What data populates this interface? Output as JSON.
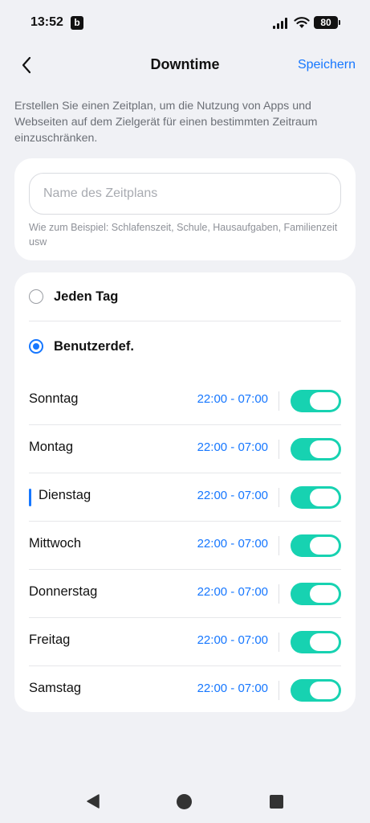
{
  "status_bar": {
    "time": "13:52",
    "app_badge": "b",
    "battery": "80"
  },
  "header": {
    "title": "Downtime",
    "save_label": "Speichern"
  },
  "description": "Erstellen Sie einen Zeitplan, um die Nutzung von Apps und Webseiten auf dem Zielgerät für einen bestimmten Zeitraum einzuschränken.",
  "name_card": {
    "placeholder": "Name des Zeitplans",
    "value": "",
    "hint": "Wie zum Beispiel: Schlafenszeit, Schule, Hausaufgaben, Familienzeit usw"
  },
  "schedule": {
    "options": [
      {
        "label": "Jeden Tag",
        "selected": false
      },
      {
        "label": "Benutzerdef.",
        "selected": true
      }
    ],
    "days": [
      {
        "name": "Sonntag",
        "time": "22:00 - 07:00",
        "enabled": true
      },
      {
        "name": "Montag",
        "time": "22:00 - 07:00",
        "enabled": true
      },
      {
        "name": "Dienstag",
        "time": "22:00 - 07:00",
        "enabled": true,
        "focused": true
      },
      {
        "name": "Mittwoch",
        "time": "22:00 - 07:00",
        "enabled": true
      },
      {
        "name": "Donnerstag",
        "time": "22:00 - 07:00",
        "enabled": true
      },
      {
        "name": "Freitag",
        "time": "22:00 - 07:00",
        "enabled": true
      },
      {
        "name": "Samstag",
        "time": "22:00 - 07:00",
        "enabled": true
      }
    ]
  },
  "colors": {
    "accent": "#1677ff",
    "toggle_on": "#17d2b1",
    "background": "#f0f1f5"
  },
  "icons": {
    "back": "chevron-left-icon",
    "nav_back": "triangle-back-icon",
    "nav_home": "circle-home-icon",
    "nav_recents": "square-recents-icon"
  }
}
